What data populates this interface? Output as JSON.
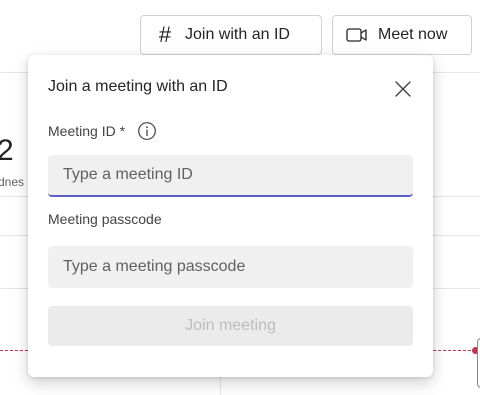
{
  "toolbar": {
    "join_with_id_label": "Join with an ID",
    "join_with_id_icon": "#",
    "meet_now_label": "Meet now"
  },
  "calendar": {
    "day_number": "2",
    "day_name": "dnes"
  },
  "dialog": {
    "title": "Join a meeting with an ID",
    "meeting_id_label": "Meeting ID *",
    "meeting_id_placeholder": "Type a meeting ID",
    "meeting_id_value": "",
    "passcode_label": "Meeting passcode",
    "passcode_placeholder": "Type a meeting passcode",
    "passcode_value": "",
    "join_button_label": "Join meeting"
  },
  "colors": {
    "accent": "#5b5fc7",
    "now_line": "#c4314b",
    "input_bg": "#f0f0f0",
    "disabled_button_bg": "#ebebeb",
    "disabled_button_text": "#bdbdbd"
  }
}
